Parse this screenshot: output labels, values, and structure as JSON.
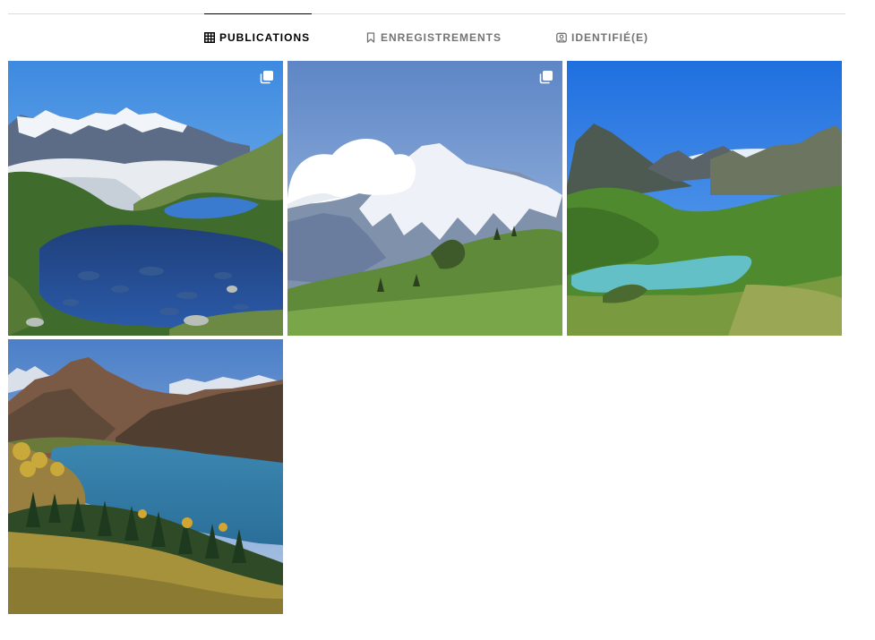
{
  "tabs": [
    {
      "label": "PUBLICATIONS",
      "icon": "grid-icon",
      "active": true
    },
    {
      "label": "ENREGISTREMENTS",
      "icon": "bookmark-icon",
      "active": false
    },
    {
      "label": "IDENTIFIÉ(E)",
      "icon": "tagged-user-icon",
      "active": false
    }
  ],
  "posts": [
    {
      "scene": "mountain lake with reflections, snow-capped massif and sea of clouds",
      "multiple": true
    },
    {
      "scene": "snowy peak with large cloud over green alpine pasture",
      "multiple": true
    },
    {
      "scene": "turquoise alpine lake in green valley under rocky peaks",
      "multiple": false
    },
    {
      "scene": "blue reservoir lake with autumn forest and mountains",
      "multiple": false
    }
  ],
  "colors": {
    "active_tab": "#000000",
    "inactive_tab": "#737373",
    "divider": "#dbdbdb"
  }
}
